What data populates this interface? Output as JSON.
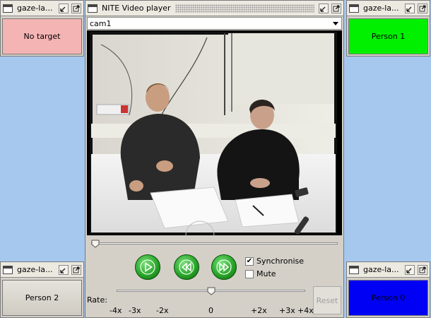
{
  "windows": {
    "no_target": {
      "title": "gaze-la...",
      "label": "No target",
      "color": "#f5b4b4"
    },
    "person1": {
      "title": "gaze-la...",
      "label": "Person 1",
      "color": "#00f000"
    },
    "person2": {
      "title": "gaze-la...",
      "label": "Person 2",
      "color": "#d4d0c8"
    },
    "person0": {
      "title": "gaze-la...",
      "label": "Person 0",
      "color": "#0000f5"
    }
  },
  "player": {
    "title": "NITE Video player",
    "camera_select": "cam1",
    "synchronise_label": "Synchronise",
    "synchronise_checked": true,
    "mute_label": "Mute",
    "mute_checked": false,
    "rate_label": "Rate:",
    "rate_ticks": [
      "-4x",
      "-3x",
      "-2x",
      "0",
      "+2x",
      "+3x",
      "+4x"
    ],
    "reset_label": "Reset",
    "position_fraction": 0.0,
    "rate_value": "0"
  },
  "icons": [
    "window-icon",
    "minimize-icon",
    "maximize-icon",
    "play-icon",
    "rewind-icon",
    "fast-forward-icon",
    "dropdown-arrow-icon"
  ]
}
